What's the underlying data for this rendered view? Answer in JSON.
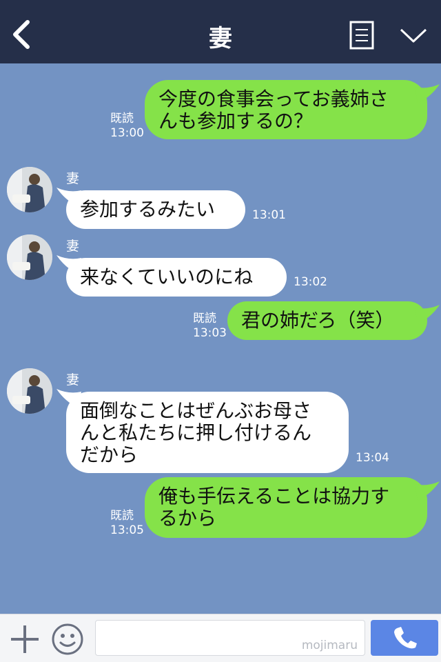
{
  "header": {
    "title": "妻"
  },
  "messages": [
    {
      "side": "me",
      "text_lines": [
        "今度の食事会ってお義姉さ",
        "んも参加するの？"
      ],
      "read": "既読",
      "time": "13:00"
    },
    {
      "side": "them",
      "sender": "妻",
      "text_lines": [
        "参加するみたい"
      ],
      "time": "13:01"
    },
    {
      "side": "them",
      "sender": "妻",
      "text_lines": [
        "来なくていいのにね"
      ],
      "time": "13:02"
    },
    {
      "side": "me",
      "text_lines": [
        "君の姉だろ（笑）"
      ],
      "read": "既読",
      "time": "13:03"
    },
    {
      "side": "them",
      "sender": "妻",
      "text_lines": [
        "面倒なことはぜんぶお母さ",
        "んと私たちに押し付けるん",
        "だから"
      ],
      "time": "13:04"
    },
    {
      "side": "me",
      "text_lines": [
        "俺も手伝えることは協力す",
        "るから"
      ],
      "read": "既読",
      "time": "13:05"
    }
  ],
  "footer": {
    "input_value": "",
    "watermark": "mojimaru"
  },
  "icons": {
    "back": "chevron-left-icon",
    "menu": "menu-list-icon",
    "collapse": "chevron-down-icon",
    "plus": "plus-icon",
    "emoji": "smiley-icon",
    "call": "phone-icon"
  },
  "colors": {
    "header_bg": "#252f49",
    "chat_bg": "#7393c3",
    "my_bubble": "#85e249",
    "their_bubble": "#ffffff",
    "call_button": "#5b86e5"
  }
}
